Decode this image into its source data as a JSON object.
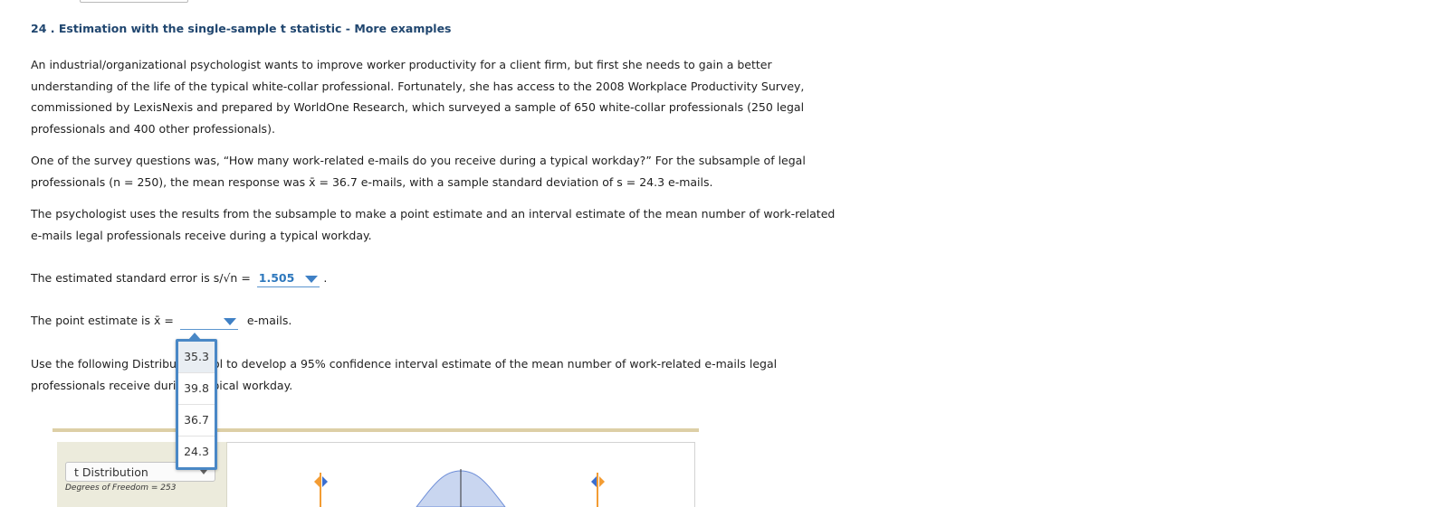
{
  "question": {
    "title": "24 . Estimation with the single-sample t statistic - More examples",
    "paragraph1": "An industrial/organizational psychologist wants to improve worker productivity for a client firm, but first she needs to gain a better understanding of the life of the typical white-collar professional. Fortunately, she has access to the 2008 Workplace Productivity Survey, commissioned by LexisNexis and prepared by WorldOne Research, which surveyed a sample of 650 white-collar professionals (250 legal professionals and 400 other professionals).",
    "paragraph2": "One of the survey questions was, “How many work-related e-mails do you receive during a typical workday?” For the subsample of legal professionals (n = 250), the mean response was x̄ = 36.7 e-mails, with a sample standard deviation of s = 24.3 e-mails.",
    "paragraph3": "The psychologist uses the results from the subsample to make a point estimate and an interval estimate of the mean number of work-related e-mails legal professionals receive during a typical workday.",
    "se_prefix": "The estimated standard error is s/√n = ",
    "se_value": "1.505",
    "se_suffix": ".",
    "pe_prefix": "The point estimate is x̄ = ",
    "pe_suffix": "e-mails.",
    "dropdown_options": [
      "35.3",
      "39.8",
      "36.7",
      "24.3"
    ],
    "paragraph4_line1_a": "Use the following Distribu",
    "paragraph4_line1_b": "ol to develop a 95% confidence interval estimate of the mean number of work-related e-mails legal",
    "paragraph4_line2_a": "professionals receive duri",
    "paragraph4_line2_b": "pical workday."
  },
  "tool": {
    "distribution_select": "t Distribution",
    "degrees_of_freedom": "Degrees of Freedom = 253"
  },
  "colors": {
    "title": "#20466f",
    "link": "#2e78bd",
    "dropdown_border": "#4a88c6",
    "rule": "#ddcfa6",
    "curve_fill": "#c9d6f0",
    "marker_orange": "#f39c33",
    "marker_blue": "#3b6fd0"
  },
  "icons": [
    "dropdown-caret-icon",
    "orange-left-marker-icon",
    "orange-right-marker-icon"
  ]
}
